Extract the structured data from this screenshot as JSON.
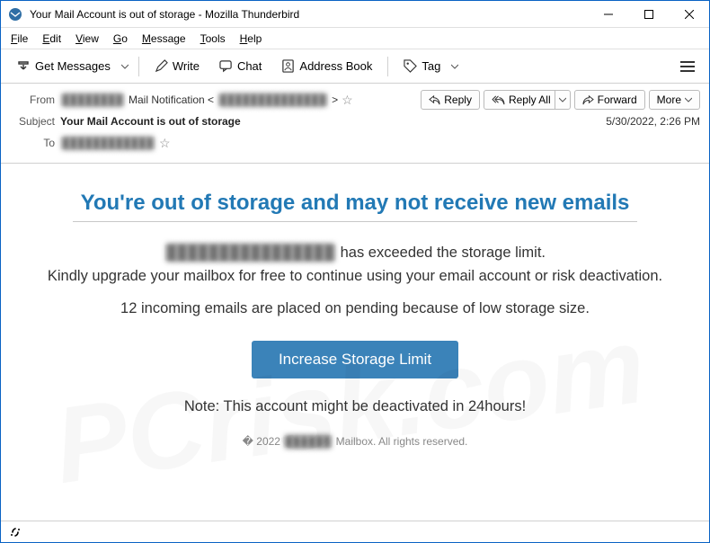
{
  "window": {
    "title": "Your Mail Account is out of storage - Mozilla Thunderbird"
  },
  "menu": {
    "file": "File",
    "edit": "Edit",
    "view": "View",
    "go": "Go",
    "message": "Message",
    "tools": "Tools",
    "help": "Help"
  },
  "toolbar": {
    "get_messages": "Get Messages",
    "write": "Write",
    "chat": "Chat",
    "address_book": "Address Book",
    "tag": "Tag"
  },
  "actions": {
    "reply": "Reply",
    "reply_all": "Reply All",
    "forward": "Forward",
    "more": "More"
  },
  "header": {
    "from_label": "From",
    "from_redacted1": "████████",
    "from_text": " Mail Notification <",
    "from_redacted2": "██████████████",
    "from_close": ">",
    "subject_label": "Subject",
    "subject_value": "Your Mail Account is out of storage",
    "to_label": "To",
    "to_redacted": "████████████",
    "datetime": "5/30/2022, 2:26 PM"
  },
  "body": {
    "headline": "You're out of storage and may not receive new emails",
    "line1_redacted": "████████████████",
    "line1_tail": " has exceeded the storage limit.",
    "line2": "Kindly upgrade your mailbox for free to continue using your email account or risk deactivation.",
    "pending": "12 incoming emails are placed on pending because of low storage size.",
    "cta": "Increase Storage Limit",
    "note": "Note: This account might be deactivated in 24hours!",
    "footer_pre": "� 2022 ",
    "footer_redacted": "██████",
    "footer_post": " Mailbox. All rights reserved."
  }
}
